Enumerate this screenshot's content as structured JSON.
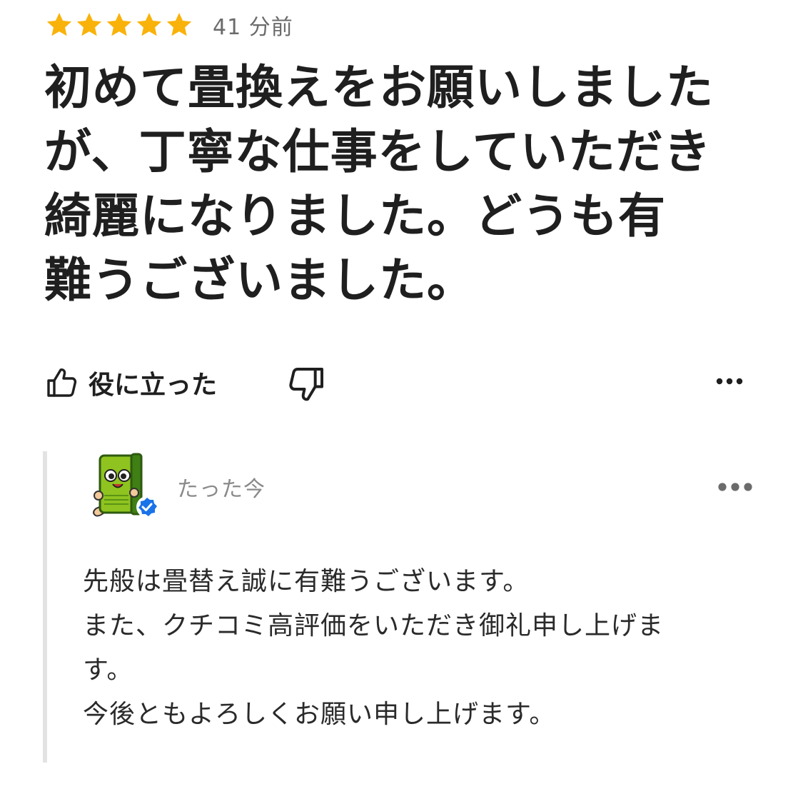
{
  "review": {
    "rating": 5,
    "rating_max": 5,
    "star_color": "#F9B20A",
    "time": "41 分前",
    "text": "初めて畳換えをお願いしました\nが、丁寧な仕事をしていただき\n綺麗になりました。どうも有\n難うございました。"
  },
  "actions": {
    "helpful_label": "役に立った",
    "helpful_icon": "thumbs-up-icon",
    "dislike_icon": "thumbs-down-icon",
    "more_icon": "more-horizontal-icon"
  },
  "reply": {
    "avatar_icon": "tatami-mascot-avatar",
    "verified_icon": "verified-badge-icon",
    "verified_color": "#1A73E8",
    "time": "たった今",
    "more_icon": "more-horizontal-icon",
    "text": "先般は畳替え誠に有難うございます。\nまた、クチコミ高評価をいただき御礼申し上げま\nす。\n今後ともよろしくお願い申し上げます。"
  }
}
